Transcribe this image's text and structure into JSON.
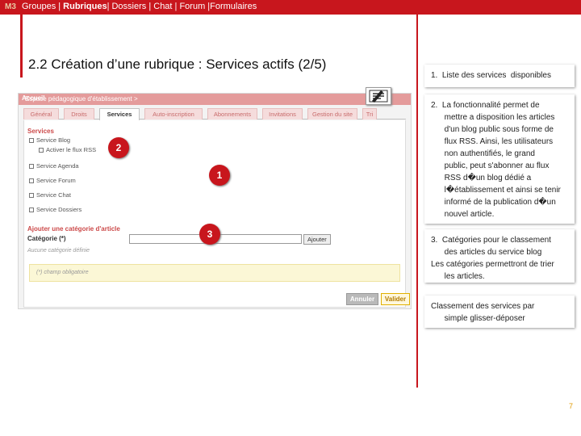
{
  "topbar": {
    "module": "M3",
    "nav_before": "Groupes | ",
    "nav_active": "Rubriques",
    "nav_after": "| Dossiers | Chat | Forum |Formulaires"
  },
  "slide_title": "2.2 Création d’une rubrique : Services actifs (2/5)",
  "screenshot": {
    "header_prefix": "Espace pédagogique d'établissement > ",
    "header_current": "Accueil",
    "tabs": [
      {
        "label": "Général",
        "active": false
      },
      {
        "label": "Droits",
        "active": false
      },
      {
        "label": "Services",
        "active": true
      },
      {
        "label": "Auto-inscription",
        "active": false
      },
      {
        "label": "Abonnements",
        "active": false
      },
      {
        "label": "Invitations",
        "active": false
      },
      {
        "label": "Gestion du site",
        "active": false
      },
      {
        "label": "Tri",
        "active": false
      }
    ],
    "services_title": "Services",
    "services": [
      {
        "label": "Service Blog"
      },
      {
        "label": "Activer le flux RSS"
      },
      {
        "label": "Service Agenda"
      },
      {
        "label": "Service Forum"
      },
      {
        "label": "Service Chat"
      },
      {
        "label": "Service Dossiers"
      }
    ],
    "add_category_title": "Ajouter une catégorie d'article",
    "category_label": "Catégorie (*)",
    "add_button": "Ajouter",
    "no_category": "Aucune catégorie définie",
    "required_note": "(*) champ obligatoire",
    "cancel_button": "Annuler",
    "validate_button": "Valider"
  },
  "markers": [
    "2",
    "1",
    "3"
  ],
  "info": {
    "box1": [
      "1.  Liste des services  disponibles"
    ],
    "box2": [
      "2.  La fonctionnalité permet de",
      "      mettre a disposition les articles",
      "      d'un blog public sous forme de",
      "      flux RSS. Ainsi, les utilisateurs",
      "      non authentifiés, le grand",
      "      public, peut s'abonner au flux",
      "      RSS d�un blog dédié a",
      "      l�établissement et ainsi se tenir",
      "      informé de la publication d�un",
      "      nouvel article."
    ],
    "box3": [
      "3.  Catégories pour le classement",
      "      des articles du service blog",
      "Les catégories permettront de trier",
      "      les articles."
    ],
    "box4": [
      "Classement des services par",
      "      simple glisser-déposer"
    ]
  },
  "page_number": "7",
  "colors": {
    "accent": "#c8161d",
    "tab_bg": "#f5dcdc",
    "note_bg": "#fbf7d6"
  }
}
